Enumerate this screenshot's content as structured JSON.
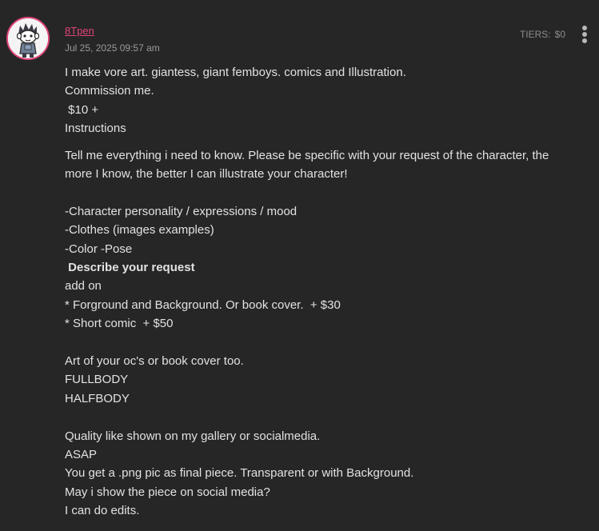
{
  "post": {
    "author": "8Tpen",
    "date": "Jul 25, 2025 09:57 am",
    "tiers_label": "TIERS:",
    "tiers_value": "$0",
    "avatar_icon": "cartoon-character-avatar-icon",
    "menu_icon": "kebab-menu-icon",
    "accent_color": "#e0447a",
    "background_color": "#262626"
  },
  "body": {
    "line_1": "I make vore art. giantess, giant femboys. comics and Illustration.",
    "line_2": "Commission me.",
    "line_3": " $10 +",
    "line_4": "Instructions",
    "para_2": "Tell me everything i need to know. Please be specific with your request of the character, the more I know, the better I can illustrate your character!",
    "line_5": "-Character personality / expressions / mood",
    "line_6": "-Clothes (images examples)",
    "line_7": "-Color -Pose",
    "line_8": " Describe your request",
    "line_9": "add on",
    "line_10": "* Forground and Background. Or book cover.  + $30",
    "line_11": "* Short comic  + $50",
    "line_12": "Art of your oc's or book cover too.",
    "line_13": "FULLBODY",
    "line_14": "HALFBODY",
    "line_15": "Quality like shown on my gallery or socialmedia.",
    "line_16": "ASAP",
    "line_17": "You get a .png pic as final piece. Transparent or with Background.",
    "line_18": "May i show the piece on social media?",
    "line_19": "I can do edits."
  }
}
